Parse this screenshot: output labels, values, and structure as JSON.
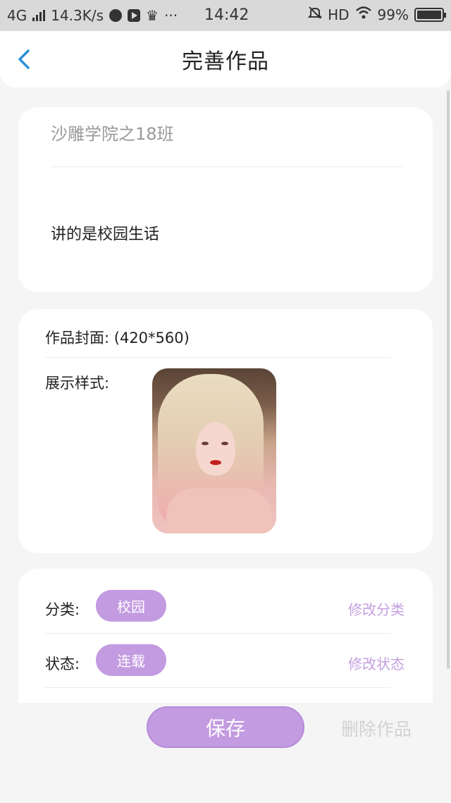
{
  "status_bar": {
    "network": "4G",
    "speed": "14.3K/s",
    "more": "···",
    "time": "14:42",
    "hd": "HD",
    "battery_text": "99%",
    "battery_level": 0.99
  },
  "nav": {
    "title": "完善作品"
  },
  "work": {
    "title": "沙雕学院之18班",
    "description": "讲的是校园生话"
  },
  "cover": {
    "label": "作品封面:",
    "size_hint": "(420*560)",
    "display_label": "展示样式:"
  },
  "category": {
    "label": "分类:",
    "value": "校园",
    "action": "修改分类"
  },
  "status": {
    "label": "状态:",
    "value": "连载",
    "action": "修改状态"
  },
  "actions": {
    "save": "保存",
    "delete": "删除作品"
  },
  "colors": {
    "accent": "#c39be1",
    "link": "#c4a0df",
    "back_arrow": "#2a8fd8"
  }
}
